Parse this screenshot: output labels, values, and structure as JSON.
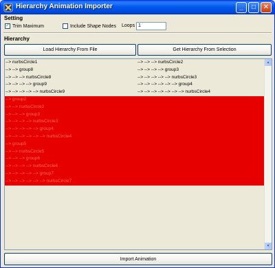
{
  "window": {
    "title": "Hierarchy Animation Importer",
    "min_glyph": "_",
    "max_glyph": "□",
    "close_glyph": "✕",
    "titlebar_color": "#0054e3"
  },
  "setting": {
    "label": "Setting",
    "trim_maximum": {
      "label": "Trim Maximum",
      "checked": true,
      "mark": "✓"
    },
    "include_shape_nodes": {
      "label": "Include Shape Nodes",
      "checked": false
    },
    "loops": {
      "label": "Loops",
      "value": "1"
    }
  },
  "hierarchy": {
    "label": "Hierarchy",
    "load_button": "Load Hierarchy From File",
    "get_button": "Get Hierarchy From Selection",
    "highlight_color": "#e60000",
    "rows": [
      {
        "c1": "--> nurbsCircle1",
        "c2": "--> --> --> nurbsCircle2",
        "selected": false
      },
      {
        "c1": "--> --> group8",
        "c2": "--> --> --> --> group3",
        "selected": false
      },
      {
        "c1": "--> --> --> nurbsCircle8",
        "c2": "--> --> --> --> --> nurbsCircle3",
        "selected": false
      },
      {
        "c1": "--> --> --> --> group9",
        "c2": "--> --> --> --> --> --> group4",
        "selected": false
      },
      {
        "c1": "--> --> --> --> --> nurbsCircle9",
        "c2": "--> --> --> --> --> --> --> nurbsCircle4",
        "selected": false
      },
      {
        "c1": "--> group2",
        "c2": "",
        "selected": true
      },
      {
        "c1": "--> --> nurbsCircle2",
        "c2": "",
        "selected": true
      },
      {
        "c1": "--> --> --> group3",
        "c2": "",
        "selected": true
      },
      {
        "c1": "--> --> --> --> nurbsCircle3",
        "c2": "",
        "selected": true
      },
      {
        "c1": "--> --> --> --> --> group4",
        "c2": "",
        "selected": true
      },
      {
        "c1": "--> --> --> --> --> --> nurbsCircle4",
        "c2": "",
        "selected": true
      },
      {
        "c1": "--> group5",
        "c2": "",
        "selected": true
      },
      {
        "c1": "--> --> nurbsCircle5",
        "c2": "",
        "selected": true
      },
      {
        "c1": "--> --> --> group6",
        "c2": "",
        "selected": true
      },
      {
        "c1": "--> --> --> --> nurbsCircle6",
        "c2": "",
        "selected": true
      },
      {
        "c1": "--> --> --> --> --> group7",
        "c2": "",
        "selected": true
      },
      {
        "c1": "--> --> --> --> --> --> nurbsCircle7",
        "c2": "",
        "selected": true
      }
    ],
    "scroll_up_glyph": "▲",
    "scroll_down_glyph": "▼"
  },
  "import_button": "Import Animation"
}
